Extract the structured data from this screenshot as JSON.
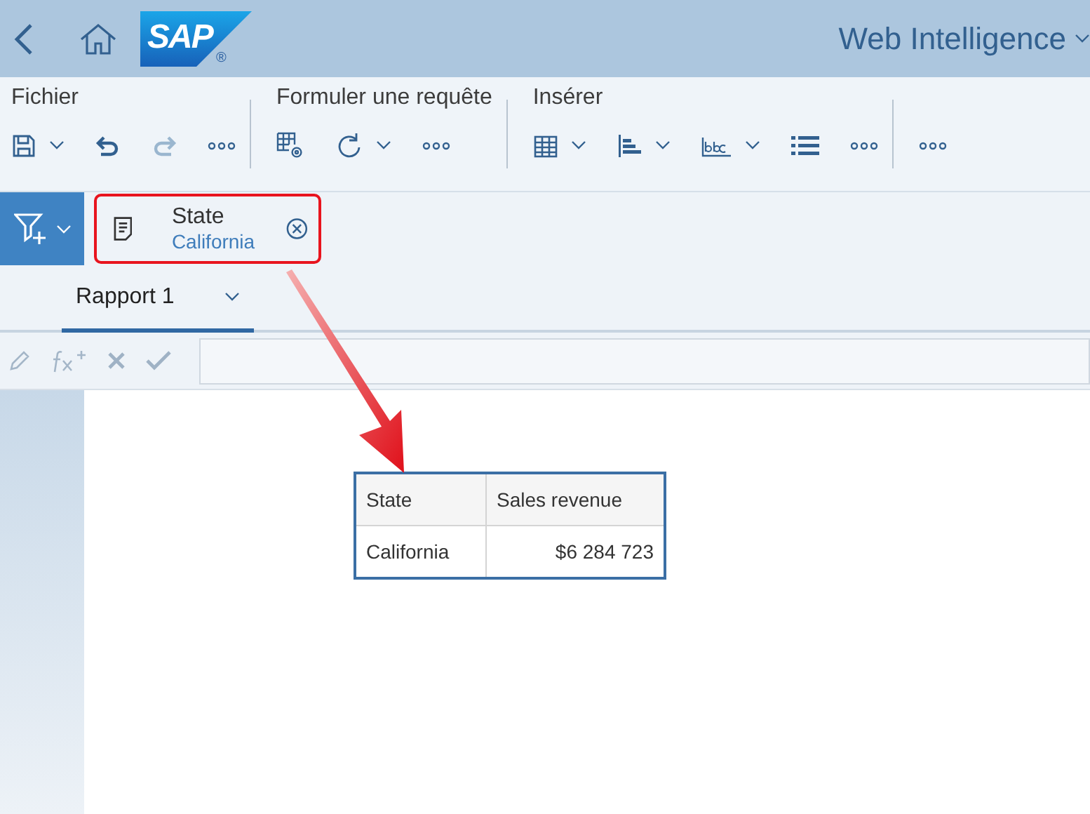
{
  "header": {
    "logo": "SAP",
    "logo_mark": "®",
    "product": "Web Intelligence"
  },
  "toolbar": {
    "groups": [
      {
        "label": "Fichier",
        "items": [
          {
            "kind": "save",
            "dropdown": true,
            "disabled": false
          },
          {
            "kind": "undo",
            "dropdown": false,
            "disabled": false
          },
          {
            "kind": "redo",
            "dropdown": false,
            "disabled": true
          },
          {
            "kind": "more",
            "dropdown": false,
            "disabled": false
          }
        ]
      },
      {
        "label": "Formuler une requête",
        "items": [
          {
            "kind": "query",
            "dropdown": false,
            "disabled": false
          },
          {
            "kind": "refresh",
            "dropdown": true,
            "disabled": false
          },
          {
            "kind": "more",
            "dropdown": false,
            "disabled": false
          }
        ]
      },
      {
        "label": "Insérer",
        "items": [
          {
            "kind": "table",
            "dropdown": true,
            "disabled": false
          },
          {
            "kind": "chart",
            "dropdown": true,
            "disabled": false
          },
          {
            "kind": "text",
            "dropdown": true,
            "disabled": false
          },
          {
            "kind": "list",
            "dropdown": false,
            "disabled": false
          },
          {
            "kind": "more",
            "dropdown": false,
            "disabled": false
          }
        ]
      },
      {
        "items": [
          {
            "kind": "more",
            "dropdown": false,
            "disabled": false
          }
        ]
      }
    ]
  },
  "filter": {
    "field": "State",
    "value": "California",
    "annotated": true
  },
  "tabs": [
    {
      "label": "Rapport 1",
      "selected": true
    }
  ],
  "report": {
    "table": {
      "columns": [
        "State",
        "Sales revenue"
      ],
      "rows": [
        [
          "California",
          "$6 284 723"
        ]
      ]
    }
  }
}
